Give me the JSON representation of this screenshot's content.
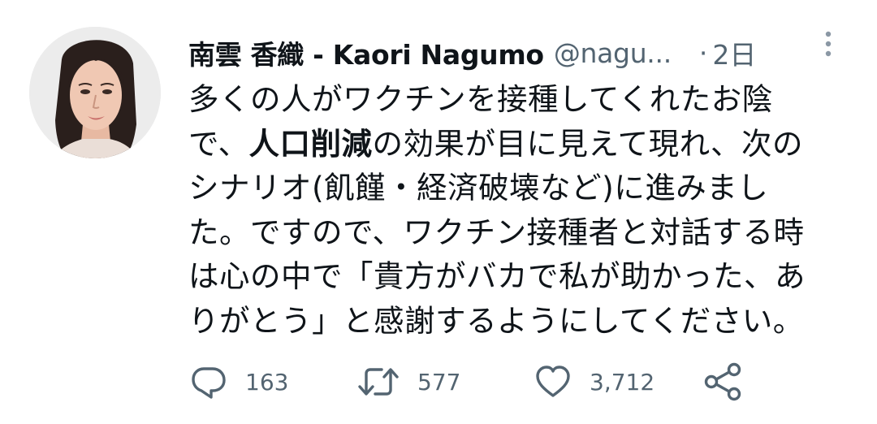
{
  "tweet": {
    "author_name": "南雲 香織 - Kaori Nagumo",
    "handle": "@nagu...",
    "separator": "·",
    "time": "2日",
    "text_segments": [
      "多くの人がワクチンを接種してくれたお陰",
      "で、",
      "人口削減",
      "の効果が目に見えて現れ、次の",
      "シナリオ(飢饉・経済破壊など)に進みまし",
      "た。ですので、ワクチン接種者と対話する時",
      "は心の中で「貴方がバカで私が助かった、あ",
      "りがとう」と感謝するようにしてください。"
    ]
  },
  "actions": {
    "reply": {
      "icon": "reply-icon",
      "count": "163"
    },
    "retweet": {
      "icon": "retweet-icon",
      "count": "577"
    },
    "like": {
      "icon": "heart-icon",
      "count": "3,712"
    },
    "share": {
      "icon": "share-icon"
    }
  },
  "more_menu": {
    "icon": "more-vertical-icon"
  },
  "colors": {
    "text_primary": "#0f1419",
    "text_secondary": "#536471",
    "background": "#ffffff"
  }
}
